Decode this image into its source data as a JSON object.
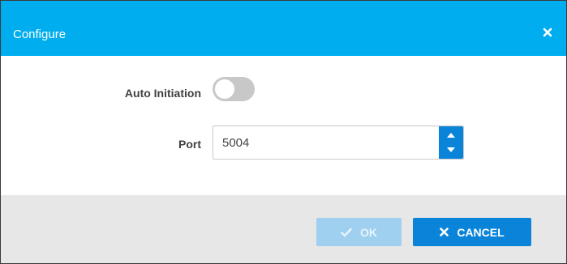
{
  "dialog": {
    "title": "Configure",
    "close_icon": "close-icon"
  },
  "form": {
    "auto_initiation": {
      "label": "Auto Initiation",
      "enabled": false
    },
    "port": {
      "label": "Port",
      "value": "5004"
    }
  },
  "footer": {
    "ok_label": "OK",
    "ok_icon": "check-icon",
    "ok_enabled": false,
    "cancel_label": "CANCEL",
    "cancel_icon": "close-icon"
  },
  "colors": {
    "header": "#00adee",
    "primary": "#0a84d8",
    "disabled_button": "#9fd0ef",
    "footer_bg": "#e7e7e7",
    "toggle_off": "#c8c8c8"
  }
}
